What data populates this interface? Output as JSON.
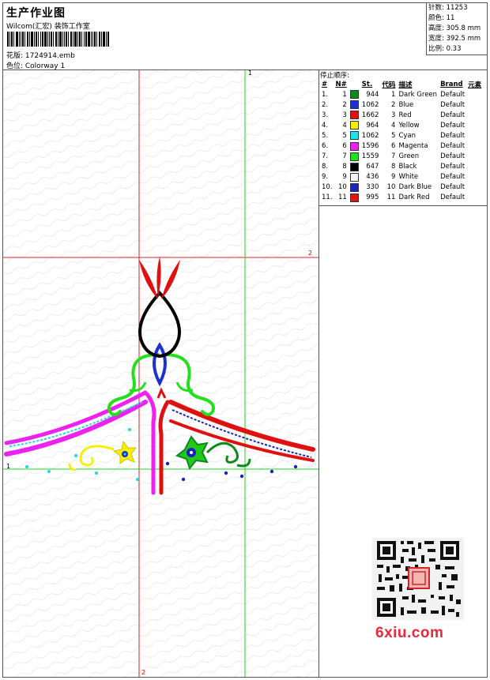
{
  "header": {
    "title": "生产作业图",
    "company": "Wilcom(汇宏) 装饰工作室",
    "design_label": "花版: 1724914.emb",
    "colorway_label": "色位: Colorway 1"
  },
  "stats": {
    "stitches": "针数: 11253",
    "colors": "颜色: 11",
    "height": "高度: 305.8 mm",
    "width": "宽度: 392.5 mm",
    "scale": "比例: 0.33"
  },
  "legend": {
    "heading": "停止顺序:",
    "columns": [
      "#",
      "N#",
      "St.",
      "代码",
      "描述",
      "Brand",
      "元素"
    ],
    "rows": [
      {
        "idx": "1.",
        "n": "1",
        "st": "944",
        "code": "1",
        "desc": "Dark Green",
        "brand": "Default",
        "color": "#0a8a1a"
      },
      {
        "idx": "2.",
        "n": "2",
        "st": "1062",
        "code": "2",
        "desc": "Blue",
        "brand": "Default",
        "color": "#1e2fd0"
      },
      {
        "idx": "3.",
        "n": "3",
        "st": "1662",
        "code": "3",
        "desc": "Red",
        "brand": "Default",
        "color": "#e01010"
      },
      {
        "idx": "4.",
        "n": "4",
        "st": "964",
        "code": "4",
        "desc": "Yellow",
        "brand": "Default",
        "color": "#f4f000"
      },
      {
        "idx": "5.",
        "n": "5",
        "st": "1062",
        "code": "5",
        "desc": "Cyan",
        "brand": "Default",
        "color": "#20e0e8"
      },
      {
        "idx": "6.",
        "n": "6",
        "st": "1596",
        "code": "6",
        "desc": "Magenta",
        "brand": "Default",
        "color": "#ee22ee"
      },
      {
        "idx": "7.",
        "n": "7",
        "st": "1559",
        "code": "7",
        "desc": "Green",
        "brand": "Default",
        "color": "#22e01a"
      },
      {
        "idx": "8.",
        "n": "8",
        "st": "647",
        "code": "8",
        "desc": "Black",
        "brand": "Default",
        "color": "#000000"
      },
      {
        "idx": "9.",
        "n": "9",
        "st": "436",
        "code": "9",
        "desc": "White",
        "brand": "Default",
        "color": "#f4f4f4"
      },
      {
        "idx": "10.",
        "n": "10",
        "st": "330",
        "code": "10",
        "desc": "Dark Blue",
        "brand": "Default",
        "color": "#1a22b8"
      },
      {
        "idx": "11.",
        "n": "11",
        "st": "995",
        "code": "11",
        "desc": "Dark Red",
        "brand": "Default",
        "color": "#d81818"
      }
    ]
  },
  "guides": {
    "green_vertical_label": "1",
    "green_horizontal_label": "1",
    "red_horizontal_label": "2",
    "red_vertical_label": "2"
  },
  "watermark": {
    "brand_text": "6xiu.com"
  }
}
